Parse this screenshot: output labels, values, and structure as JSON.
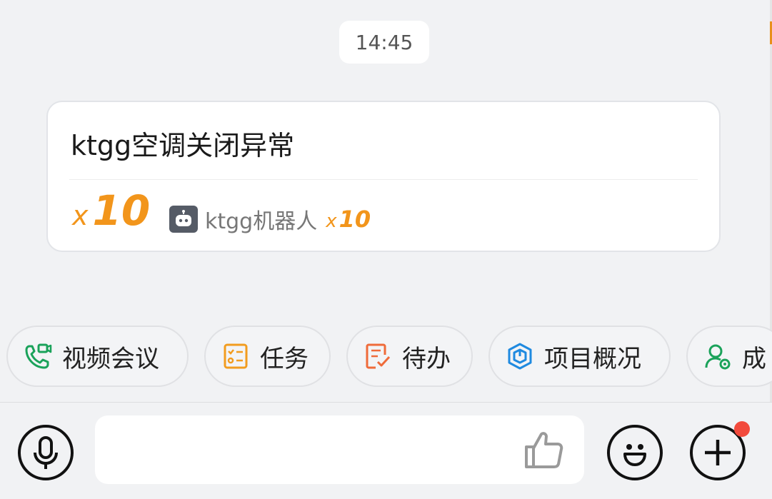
{
  "chat": {
    "timestamp": "14:45",
    "message": {
      "title": "ktgg空调关闭异常",
      "reaction_total_prefix": "x",
      "reaction_total": "10",
      "reactor_name": "ktgg机器人",
      "reactor_count_prefix": "x",
      "reactor_count": "10"
    }
  },
  "quick_actions": [
    {
      "label": "视频会议",
      "icon": "video-call-icon",
      "color": "#1aa25a"
    },
    {
      "label": "任务",
      "icon": "task-list-icon",
      "color": "#f29c1f"
    },
    {
      "label": "待办",
      "icon": "todo-check-icon",
      "color": "#ef6b3a"
    },
    {
      "label": "项目概况",
      "icon": "project-cube-icon",
      "color": "#1f8ae0"
    },
    {
      "label": "成",
      "icon": "member-settings-icon",
      "color": "#1aa25a"
    }
  ],
  "input_bar": {
    "placeholder": ""
  },
  "colors": {
    "accent": "#f2951b",
    "badge": "#f24a3c"
  }
}
